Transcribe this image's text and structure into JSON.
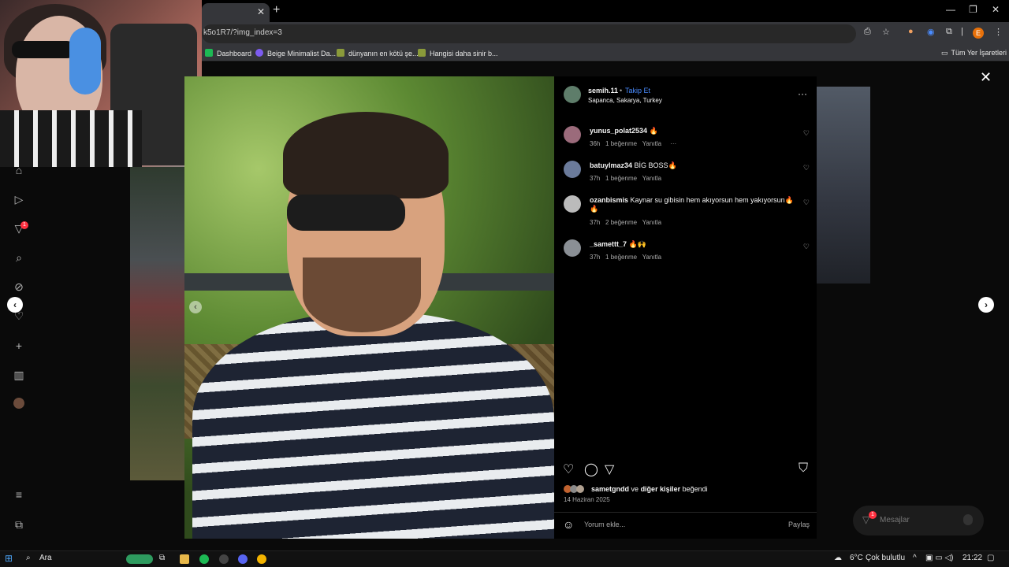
{
  "browser": {
    "url": "k5o1R7/?img_index=3",
    "bookmarks": [
      "Dashboard",
      "Beige Minimalist Da...",
      "dünyanın en kötü şe...",
      "Hangisi daha sinir b..."
    ],
    "all_bookmarks": "Tüm Yer İşaretleri",
    "profile_initial": "E"
  },
  "post": {
    "username": "semih.11",
    "follow": "Takip Et",
    "location": "Sapanca, Sakarya, Turkey",
    "comments": [
      {
        "user": "yunus_polat2534",
        "text": "🔥",
        "time": "36h",
        "likes": "1 beğenme",
        "reply": "Yanıtla"
      },
      {
        "user": "batuylmaz34",
        "text": "BİG BOSS🔥",
        "time": "37h",
        "likes": "1 beğenme",
        "reply": "Yanıtla"
      },
      {
        "user": "ozanbismis",
        "text": "Kaynar su gibisin hem akıyorsun hem yakıyorsun🔥",
        "text2": "🔥",
        "time": "37h",
        "likes": "2 beğenme",
        "reply": "Yanıtla"
      },
      {
        "user": "_samettt_7",
        "text": "🔥🙌",
        "time": "37h",
        "likes": "1 beğenme",
        "reply": "Yanıtla"
      }
    ],
    "liked_by_user": "sametgndd",
    "liked_by_and": "ve",
    "liked_by_others": "diğer kişiler",
    "liked_by_suffix": "beğendi",
    "date": "14 Haziran 2025",
    "comment_placeholder": "Yorum ekle...",
    "share": "Paylaş"
  },
  "messages": {
    "label": "Mesajlar",
    "badge": "1"
  },
  "sidebar": {
    "notif_badge": "1"
  },
  "taskbar": {
    "search": "Ara",
    "weather_temp": "6°C",
    "weather_text": "Çok bulutlu",
    "time": "21:22"
  }
}
